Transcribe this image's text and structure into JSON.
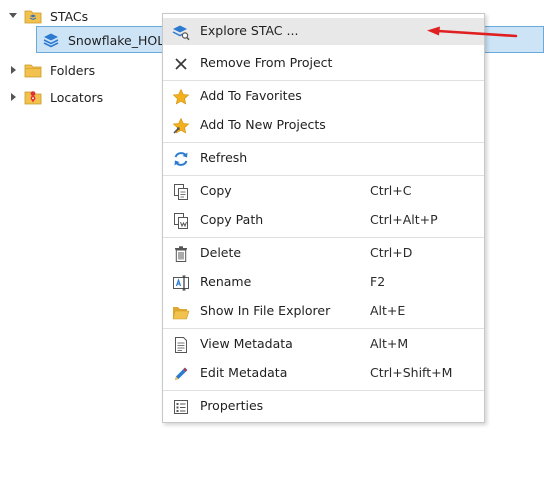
{
  "tree": {
    "items": [
      {
        "label": "STACs",
        "icon": "stac-folder-icon",
        "expanded": true
      },
      {
        "label": "Snowflake_HOL",
        "icon": "stac-connection-icon",
        "selected": true
      },
      {
        "label": "Folders",
        "icon": "folder-icon",
        "expanded": false
      },
      {
        "label": "Locators",
        "icon": "locator-folder-icon",
        "expanded": false
      }
    ]
  },
  "context_menu": {
    "items": [
      {
        "label": "Explore STAC ...",
        "shortcut": "",
        "icon": "explore-stac-icon",
        "hovered": true
      },
      {
        "label": "Remove From Project",
        "shortcut": "",
        "icon": "close-icon"
      },
      {
        "label": "Add To Favorites",
        "shortcut": "",
        "icon": "star-icon"
      },
      {
        "label": "Add To New Projects",
        "shortcut": "",
        "icon": "star-add-icon"
      },
      {
        "label": "Refresh",
        "shortcut": "",
        "icon": "refresh-icon"
      },
      {
        "label": "Copy",
        "shortcut": "Ctrl+C",
        "icon": "copy-icon"
      },
      {
        "label": "Copy Path",
        "shortcut": "Ctrl+Alt+P",
        "icon": "copy-path-icon"
      },
      {
        "label": "Delete",
        "shortcut": "Ctrl+D",
        "icon": "trash-icon"
      },
      {
        "label": "Rename",
        "shortcut": "F2",
        "icon": "rename-icon"
      },
      {
        "label": "Show In File Explorer",
        "shortcut": "Alt+E",
        "icon": "open-folder-icon"
      },
      {
        "label": "View Metadata",
        "shortcut": "Alt+M",
        "icon": "document-icon"
      },
      {
        "label": "Edit Metadata",
        "shortcut": "Ctrl+Shift+M",
        "icon": "pencil-icon"
      },
      {
        "label": "Properties",
        "shortcut": "",
        "icon": "properties-icon"
      }
    ]
  },
  "colors": {
    "selection_fill": "#cde4f7",
    "selection_border": "#6aa9dc",
    "hover_fill": "#e8e8e8",
    "annotation_arrow": "#e02020",
    "accent_blue": "#2d7bd1",
    "folder_yellow": "#f2c14e"
  }
}
